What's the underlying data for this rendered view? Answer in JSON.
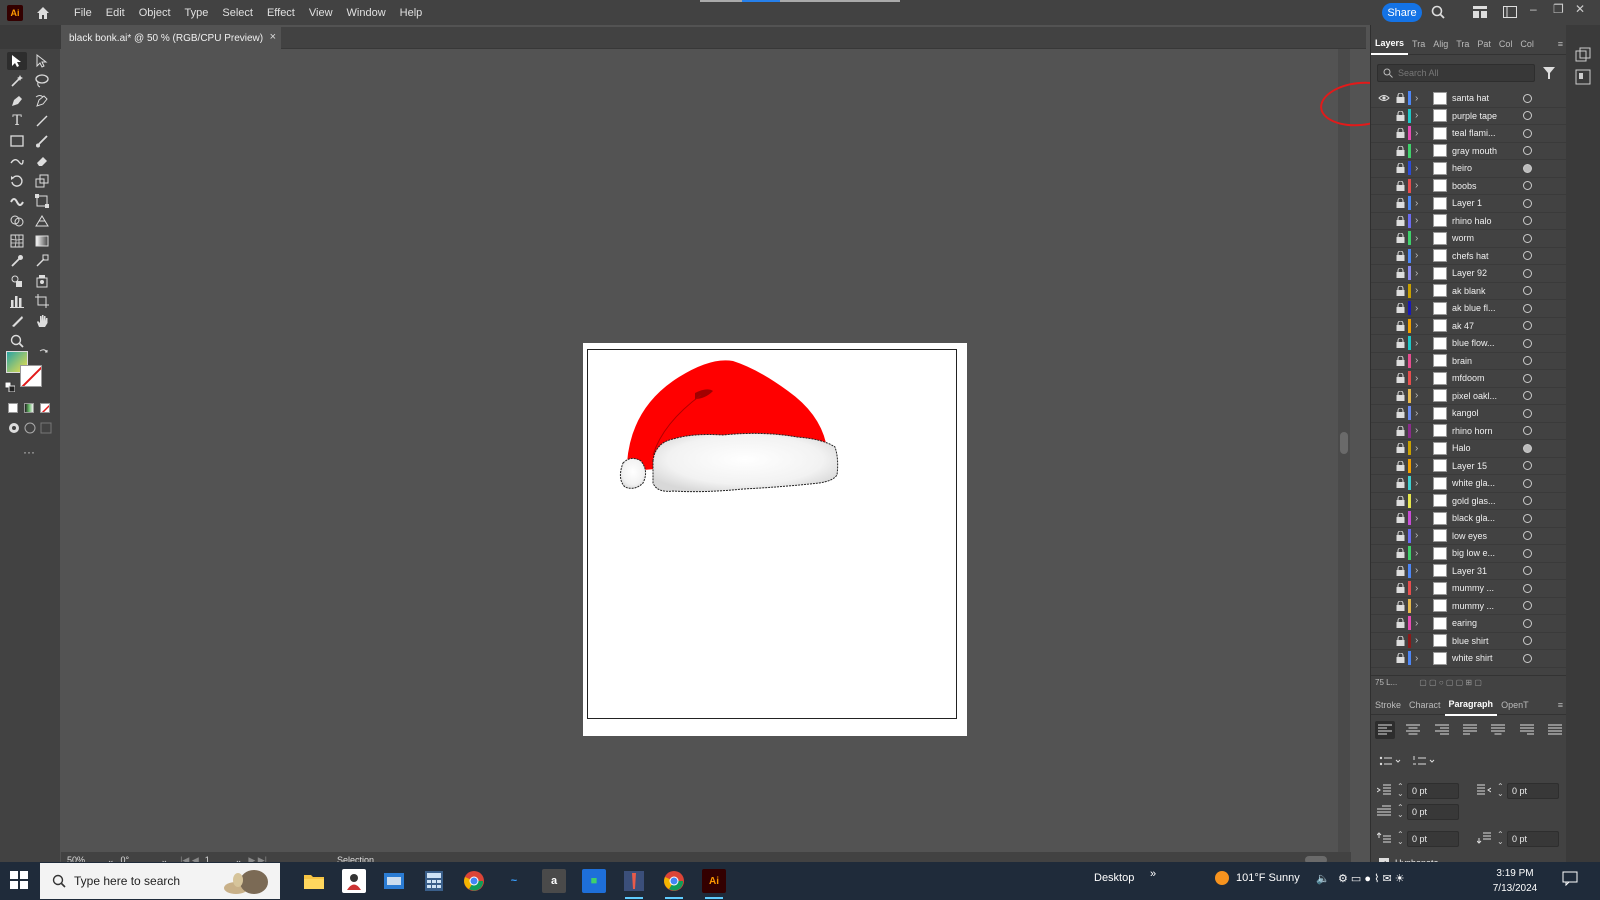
{
  "app": {
    "logo": "Ai"
  },
  "menu": [
    "File",
    "Edit",
    "Object",
    "Type",
    "Select",
    "Effect",
    "View",
    "Window",
    "Help"
  ],
  "share": "Share",
  "document_tab": {
    "title": "black bonk.ai* @ 50 % (RGB/CPU Preview)",
    "close": "×"
  },
  "status": {
    "zoom": "50%",
    "rotation": "0°",
    "artboard": "1",
    "tool": "Selection"
  },
  "panel": {
    "tabs": [
      "Layers",
      "Tra",
      "Alig",
      "Tra",
      "Pat",
      "Col",
      "Col"
    ],
    "search_placeholder": "Search All",
    "layers": [
      {
        "name": "santa hat",
        "color": "#4d86f5",
        "visible": true
      },
      {
        "name": "purple tape",
        "color": "#1ec8c8"
      },
      {
        "name": "teal flami...",
        "color": "#e64db3"
      },
      {
        "name": "gray mouth",
        "color": "#3fd16b"
      },
      {
        "name": "heiro",
        "color": "#2c4bd6",
        "filled": true
      },
      {
        "name": "boobs",
        "color": "#e64d4d"
      },
      {
        "name": "Layer 1",
        "color": "#4d86f5"
      },
      {
        "name": "rhino halo",
        "color": "#6b6bf0"
      },
      {
        "name": "worm",
        "color": "#3fd16b"
      },
      {
        "name": "chefs hat",
        "color": "#4d86f5"
      },
      {
        "name": "Layer 92",
        "color": "#8a8af0"
      },
      {
        "name": "ak blank",
        "color": "#c8a000"
      },
      {
        "name": "ak blue fl...",
        "color": "#1a1ab8"
      },
      {
        "name": "ak 47",
        "color": "#f0a000"
      },
      {
        "name": "blue flow...",
        "color": "#1ec8c8"
      },
      {
        "name": "brain",
        "color": "#e64d90"
      },
      {
        "name": "mfdoom",
        "color": "#e64d4d"
      },
      {
        "name": "pixel oakl...",
        "color": "#e6b84d"
      },
      {
        "name": "kangol",
        "color": "#6b8af0"
      },
      {
        "name": "rhino horn",
        "color": "#8a2c8a"
      },
      {
        "name": "Halo",
        "color": "#c8a000",
        "filled": true
      },
      {
        "name": "Layer 15",
        "color": "#f0a000"
      },
      {
        "name": "white gla...",
        "color": "#3fd1d1"
      },
      {
        "name": "gold glas...",
        "color": "#e6e64d"
      },
      {
        "name": "black gla...",
        "color": "#c84dd6"
      },
      {
        "name": "low eyes",
        "color": "#6b6bf0"
      },
      {
        "name": "big low e...",
        "color": "#3fd16b"
      },
      {
        "name": "Layer 31",
        "color": "#4d86f5"
      },
      {
        "name": "mummy ...",
        "color": "#e64d4d"
      },
      {
        "name": "mummy ...",
        "color": "#e6b84d"
      },
      {
        "name": "earing",
        "color": "#e64db3"
      },
      {
        "name": "blue shirt",
        "color": "#8a1a1a"
      },
      {
        "name": "white shirt",
        "color": "#4d86f5"
      }
    ],
    "layers_count": "75 L...",
    "para_tabs": [
      "Stroke",
      "Charact",
      "Paragraph",
      "OpenT"
    ],
    "fields": {
      "left_indent": "0 pt",
      "right_indent": "0 pt",
      "first_line": "0 pt",
      "space_before": "0 pt",
      "space_after": "0 pt"
    },
    "hyphenate": "Hyphenate"
  },
  "taskbar": {
    "search": "Type here to search",
    "desktop": "Desktop",
    "weather": "101°F  Sunny",
    "time": "3:19 PM",
    "date": "7/13/2024"
  }
}
